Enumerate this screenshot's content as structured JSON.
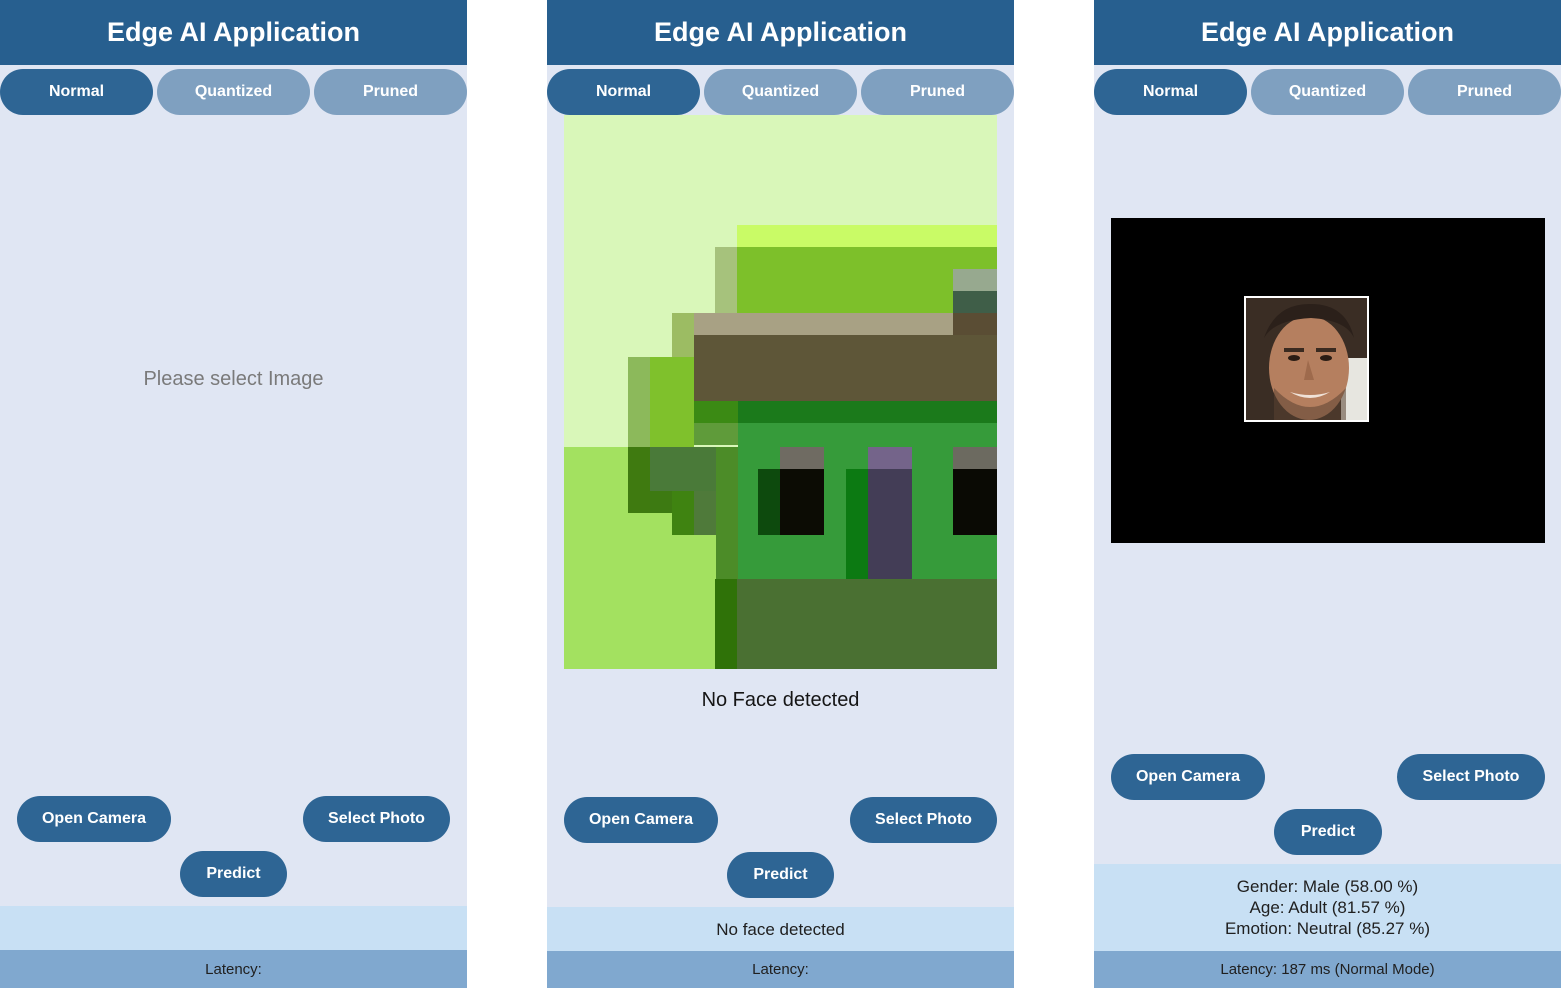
{
  "app_title": "Edge AI Application",
  "tabs": [
    "Normal",
    "Quantized",
    "Pruned"
  ],
  "buttons": {
    "open_camera": "Open Camera",
    "select_photo": "Select Photo",
    "predict": "Predict"
  },
  "screens": [
    {
      "placeholder": "Please select Image",
      "result_lines": [],
      "latency": "Latency:"
    },
    {
      "image_status": "No Face detected",
      "result_lines": [
        "No face detected"
      ],
      "latency": "Latency:"
    },
    {
      "result_lines": [
        "Gender: Male (58.00 %)",
        "Age: Adult (81.57 %)",
        "Emotion: Neutral (85.27 %)"
      ],
      "latency": "Latency: 187 ms (Normal Mode)"
    }
  ],
  "colors": {
    "header": "#275f8f",
    "tab_active": "#2e6594",
    "tab_inactive": "#7fa0c0",
    "background": "#e0e6f3",
    "result_band": "#c8e0f4",
    "latency_bar": "#80a8cf"
  }
}
